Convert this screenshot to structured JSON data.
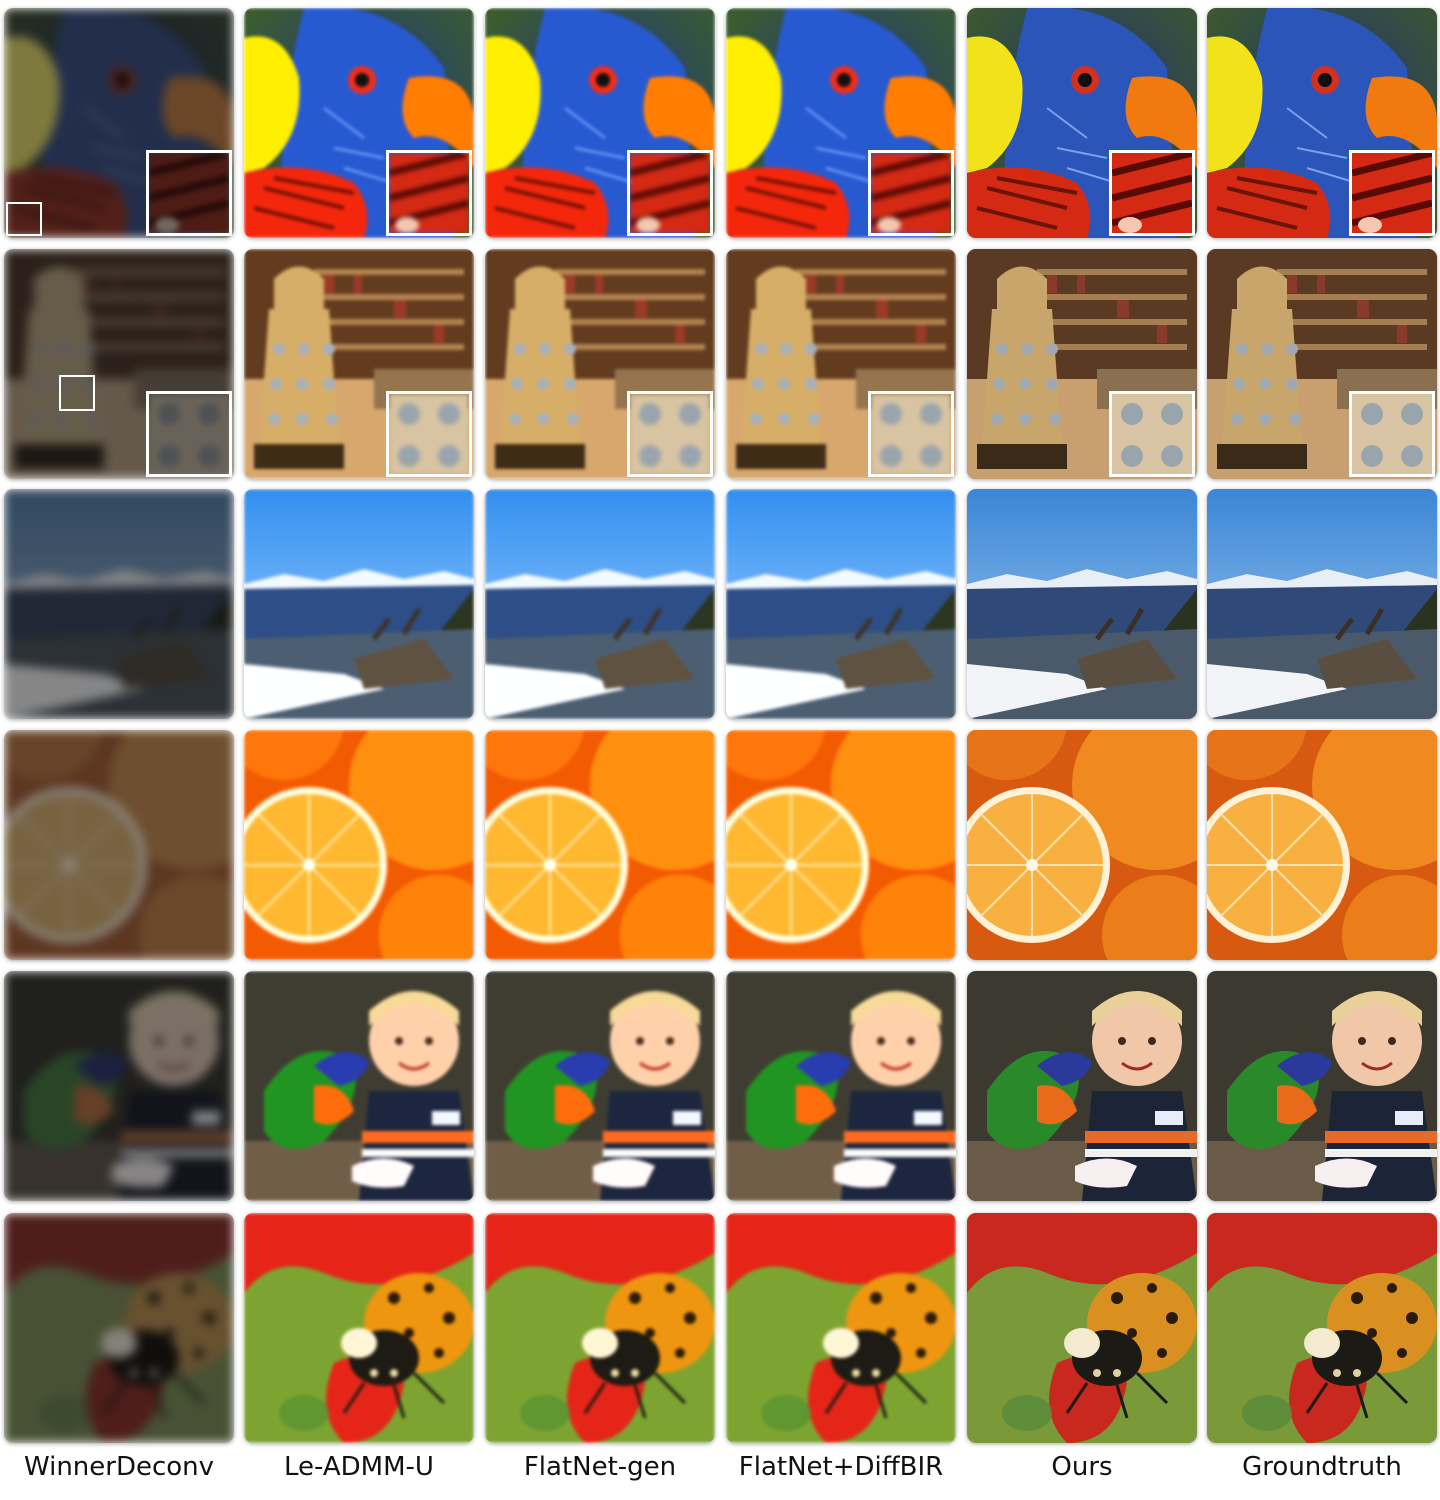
{
  "columns": [
    {
      "label": "WinnerDeconv",
      "style": "blurdark"
    },
    {
      "label": "Le-ADMM-U",
      "style": "smooth"
    },
    {
      "label": "FlatNet-gen",
      "style": "smooth"
    },
    {
      "label": "FlatNet+DiffBIR",
      "style": "smooth"
    },
    {
      "label": "Ours",
      "style": "sharp"
    },
    {
      "label": "Groundtruth",
      "style": "sharp"
    }
  ],
  "rows": [
    {
      "scene": "parrot-closeup",
      "has_inset": true
    },
    {
      "scene": "dalek-in-bookstore",
      "has_inset": true
    },
    {
      "scene": "mountain-valley-ruins",
      "has_inset": false
    },
    {
      "scene": "oranges",
      "has_inset": false
    },
    {
      "scene": "child-with-lorikeet",
      "has_inset": false
    },
    {
      "scene": "ladybug-on-flower",
      "has_inset": false
    }
  ],
  "colors": {
    "parrot_blue": "#2b55b8",
    "parrot_yellow": "#f2e21a",
    "parrot_orange": "#f07a10",
    "parrot_red": "#d42a14",
    "parrot_bg": "#3d5a2a",
    "shelf_brown": "#5a3a22",
    "dalek_gold": "#c8a66b",
    "sky_blue": "#3a86d6",
    "mountain_blue": "#2f4a78",
    "snow": "#f2f4f8",
    "orange": "#f08a20",
    "orange_flesh": "#f8b040",
    "ladybug": "#d99020",
    "flower_red": "#c8281e",
    "leaf_green": "#7a9a3a"
  }
}
